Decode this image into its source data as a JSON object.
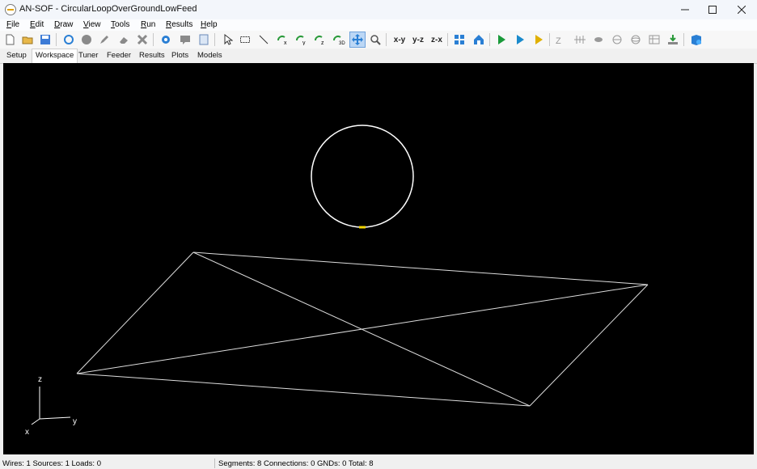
{
  "window": {
    "title": "AN-SOF - CircularLoopOverGroundLowFeed"
  },
  "menu": [
    {
      "key": "F",
      "rest": "ile"
    },
    {
      "key": "E",
      "rest": "dit"
    },
    {
      "key": "D",
      "rest": "raw"
    },
    {
      "key": "V",
      "rest": "iew"
    },
    {
      "key": "T",
      "rest": "ools"
    },
    {
      "key": "R",
      "rest": "un"
    },
    {
      "key": "R",
      "rest": "esults"
    },
    {
      "key": "H",
      "rest": "elp"
    }
  ],
  "toolbar": {
    "view_xy": "x-y",
    "view_yz": "y-z",
    "view_zx": "z-x"
  },
  "tabs": [
    "Setup",
    "Workspace",
    "Tuner",
    "Feeder",
    "Results",
    "Plots",
    "Models"
  ],
  "axes": {
    "z": "z",
    "y": "y",
    "x": "x"
  },
  "status": {
    "left": "Wires: 1  Sources: 1  Loads: 0",
    "right": "Segments: 8  Connections: 0  GNDs: 0  Total: 8"
  },
  "colors": {
    "viewport_bg": "#000000",
    "wire": "#ffffff",
    "source": "#f2d600"
  }
}
